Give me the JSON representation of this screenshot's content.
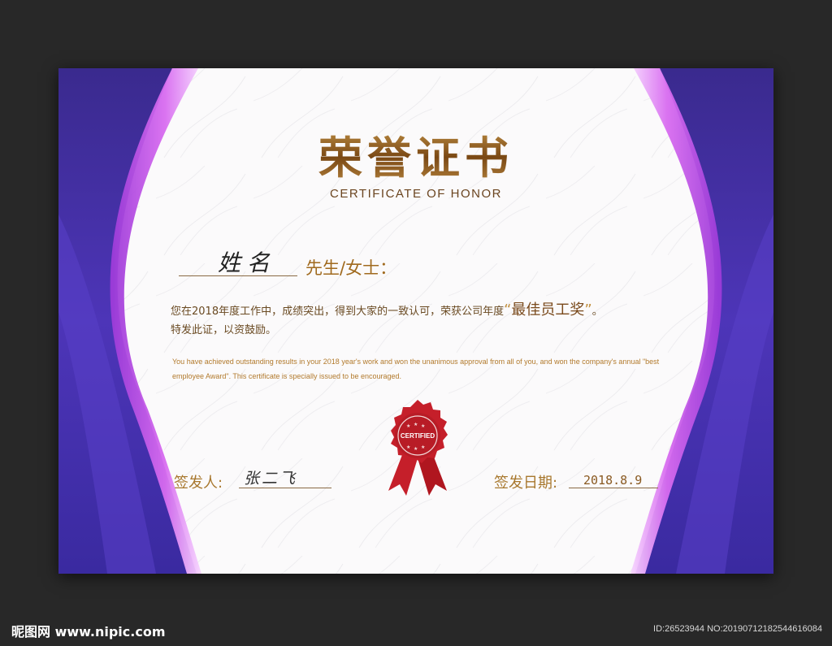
{
  "certificate": {
    "title": "荣誉证书",
    "subtitle": "CERTIFICATE OF HONOR",
    "name": "姓名",
    "honorific": "先生/女士：",
    "body_cn_line1_prefix": "您在2018年度工作中，成绩突出，得到大家的一致认可，荣获公司年度",
    "award_open_quote": "“",
    "award_name": "最佳员工奖",
    "award_close_quote": "”",
    "body_cn_line1_suffix": "。",
    "body_cn_line2": "特发此证，以资鼓励。",
    "body_en": "You have achieved outstanding results in your 2018 year's work and won the unanimous approval from all of you, and won the company's annual \"best employee Award\". This certificate is specially issued to be encouraged.",
    "seal_text": "CERTIFIED",
    "issuer_label": "签发人:",
    "issuer_signature": "张二飞",
    "date_label": "签发日期:",
    "date_value": "2018.8.9"
  },
  "footer": {
    "watermark": "昵图网 www.nipic.com",
    "image_id": "ID:26523944 NO:20190712182544616084"
  },
  "colors": {
    "purple_dark": "#3a2a9a",
    "purple_light": "#c54ee0",
    "gold": "#a8782e",
    "seal_red": "#c51f2a"
  }
}
